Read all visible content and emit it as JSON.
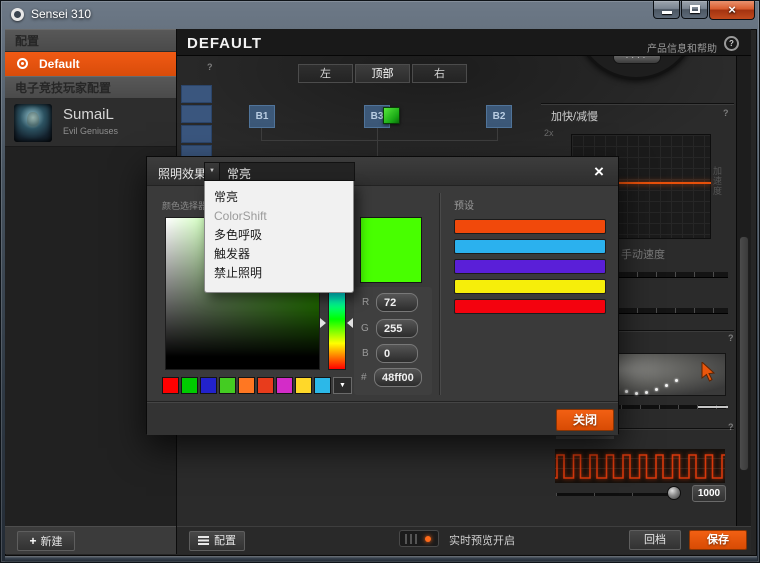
{
  "window": {
    "title": "Sensei 310"
  },
  "sidebar": {
    "config_header": "配置",
    "default_profile": "Default",
    "esports_header": "电子竞技玩家配置",
    "player_name": "SumaiL",
    "player_team": "Evil Geniuses",
    "new_button": "新建"
  },
  "main": {
    "title": "DEFAULT",
    "help_label": "产品信息和帮助",
    "tabs": [
      "左",
      "顶部",
      "右"
    ],
    "mouse_buttons": [
      "B1",
      "B3",
      "B2"
    ],
    "dial_indicator": "····"
  },
  "panels": {
    "accel_title": "加快/减慢",
    "accel_scale": "2x",
    "accel_axis_label": "加速度",
    "manual_speed_label": "手动速度",
    "polling_value": "1000",
    "help_glyph": "?"
  },
  "dialog": {
    "title": "照明效果",
    "selected_effect": "常亮",
    "effect_options": [
      "常亮",
      "ColorShift",
      "多色呼吸",
      "触发器",
      "禁止照明"
    ],
    "color_picker_label": "颜色选择器",
    "presets_label": "预设",
    "r_label": "R",
    "g_label": "G",
    "b_label": "B",
    "hex_label": "#",
    "r_value": "72",
    "g_value": "255",
    "b_value": "0",
    "hex_value": "48ff00",
    "current_color": "#48ff00",
    "swatches": [
      "#ff0000",
      "#00cc00",
      "#2222cc",
      "#44cc22",
      "#ff7722",
      "#e83c1c",
      "#d32cc8",
      "#ffd829",
      "#2cb8e8"
    ],
    "presets": [
      "#f1490b",
      "#2bb1ee",
      "#5a1fd8",
      "#f6ee0a",
      "#f4020e"
    ],
    "close_button": "关闭",
    "dropdown_glyph": "▼"
  },
  "bottom_bar": {
    "config_button": "配置",
    "preview_label": "实时预览开启",
    "rollback_button": "回档",
    "save_button": "保存"
  }
}
